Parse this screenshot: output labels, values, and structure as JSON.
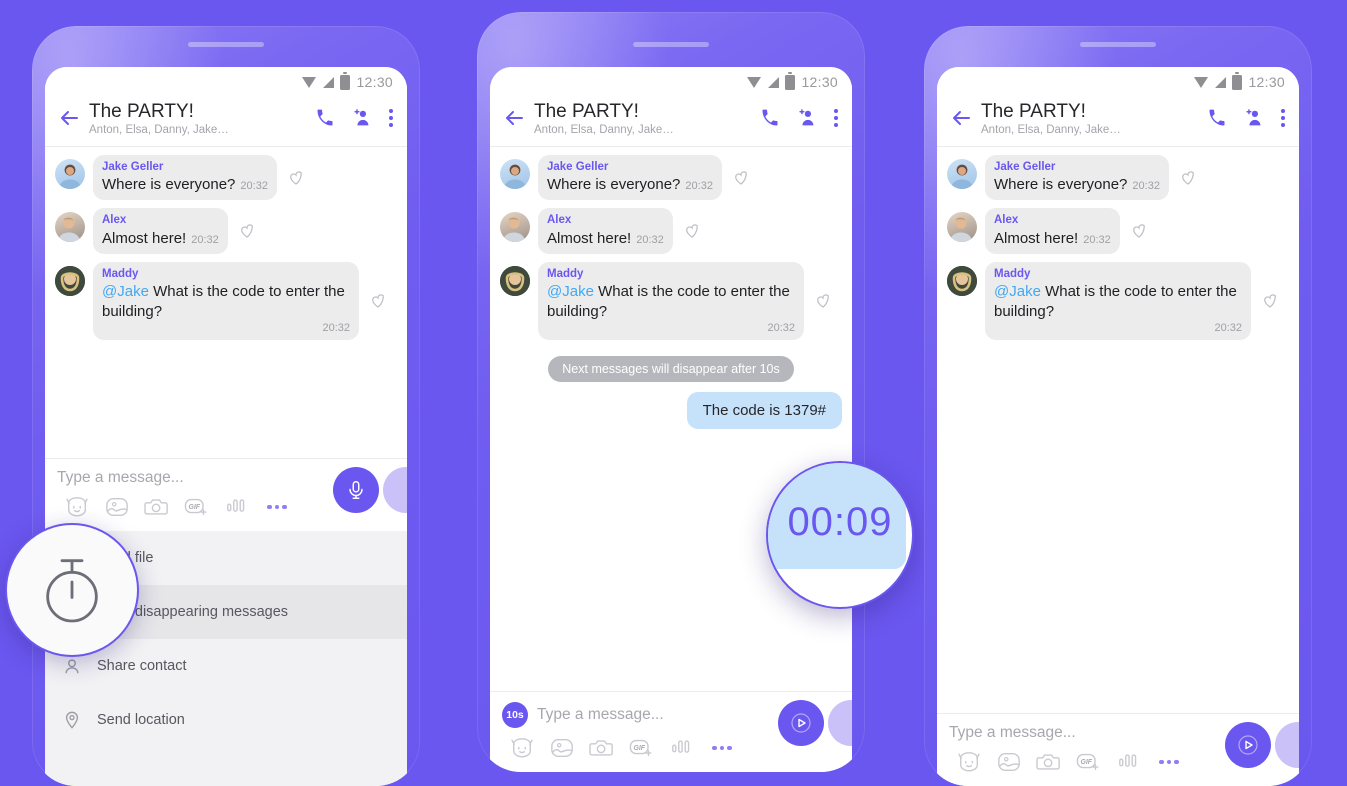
{
  "theme": {
    "background": "#6a57ef",
    "accent": "#6a57ef",
    "incoming_bubble": "#ececec",
    "outgoing_bubble": "#c6e2fb",
    "notice_bubble": "#b6b6bd",
    "mention_color": "#3fa9f5",
    "sheet_background": "#f2f2f4"
  },
  "status_bar": {
    "time": "12:30",
    "icons": [
      "wifi-icon",
      "signal-icon",
      "battery-icon"
    ]
  },
  "header": {
    "back_icon": "back-arrow-icon",
    "title": "The PARTY!",
    "subtitle": "Anton, Elsa, Danny, Jake…",
    "actions": [
      {
        "name": "call-icon",
        "label": "Call"
      },
      {
        "name": "add-participant-icon",
        "label": "Add participant"
      },
      {
        "name": "overflow-menu-icon",
        "label": "More options"
      }
    ]
  },
  "messages": [
    {
      "sender": "Jake Geller",
      "text": "Where is everyone?",
      "time": "20:32",
      "mention": "",
      "avatar": "avatar-jake"
    },
    {
      "sender": "Alex",
      "text": "Almost here!",
      "time": "20:32",
      "mention": "",
      "avatar": "avatar-alex"
    },
    {
      "sender": "Maddy",
      "mention": "@Jake",
      "text": "What is the code to enter the building?",
      "time": "20:32",
      "avatar": "avatar-maddy"
    }
  ],
  "composer": {
    "placeholder": "Type a message...",
    "timer_badge": "10s",
    "icons": [
      "sticker-icon",
      "gallery-icon",
      "camera-icon",
      "gif-icon",
      "voice-wave-icon",
      "more-options-icon"
    ],
    "mic_button": "microphone-icon",
    "send_button": "send-play-icon"
  },
  "attachment_sheet": {
    "items": [
      {
        "label": "Send file",
        "icon": "file-icon",
        "highlighted": false
      },
      {
        "label": "Send disappearing messages",
        "icon": "stopwatch-icon",
        "highlighted": true
      },
      {
        "label": "Share contact",
        "icon": "contact-icon",
        "highlighted": false
      },
      {
        "label": "Send location",
        "icon": "location-pin-icon",
        "highlighted": false
      }
    ]
  },
  "disappearing": {
    "notice": "Next messages will disappear after 10s",
    "outgoing_message": "The code is 1379#",
    "countdown": "00:09"
  },
  "lenses": {
    "stopwatch_lens": "stopwatch-icon",
    "countdown_lens": "00:09"
  },
  "phones": [
    {
      "id": "phone-1",
      "state": "attachment-menu-open"
    },
    {
      "id": "phone-2",
      "state": "disappearing-message-sent"
    },
    {
      "id": "phone-3",
      "state": "messages-disappeared"
    }
  ]
}
